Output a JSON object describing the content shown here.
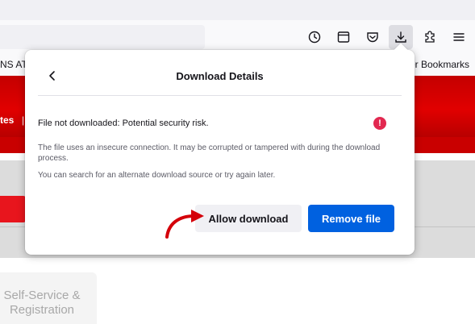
{
  "browser": {
    "bookmarks_left": "NS AT",
    "bookmarks_right": "er Bookmarks",
    "toolbar_icons": [
      "history-icon",
      "sidebar-icon",
      "pocket-icon",
      "downloads-icon",
      "extensions-icon",
      "menu-icon"
    ]
  },
  "page_background": {
    "nav_fragment": "tes",
    "nav_separator": "|",
    "card_text": "Self-Service & Registration"
  },
  "download_panel": {
    "title": "Download Details",
    "warning": "File not downloaded: Potential security risk.",
    "description_1": "The file uses an insecure connection. It may be corrupted or tampered with during the download process.",
    "description_2": "You can search for an alternate download source or try again later.",
    "allow_label": "Allow download",
    "remove_label": "Remove file",
    "warning_symbol": "!"
  },
  "colors": {
    "accent_blue": "#0061e0",
    "warning_red": "#e22850",
    "site_red": "#d90000",
    "annotation_arrow": "#d4000a"
  }
}
